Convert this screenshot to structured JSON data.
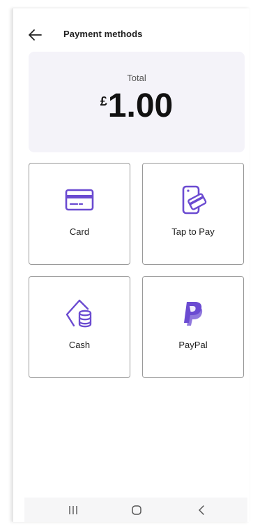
{
  "header": {
    "title": "Payment methods",
    "back_icon": "arrow-left-icon"
  },
  "total": {
    "label": "Total",
    "currency": "£",
    "amount": "1.00"
  },
  "methods": [
    {
      "label": "Card",
      "icon": "credit-card-icon"
    },
    {
      "label": "Tap to Pay",
      "icon": "tap-to-pay-icon"
    },
    {
      "label": "Cash",
      "icon": "cash-icon"
    },
    {
      "label": "PayPal",
      "icon": "paypal-icon"
    }
  ],
  "nav": {
    "recents_icon": "recents-icon",
    "home_icon": "home-icon",
    "back_icon": "back-chevron-icon"
  },
  "colors": {
    "accent": "#6b4bd1",
    "total_bg": "#f4f3f9",
    "tile_border": "#9a9a9a"
  }
}
